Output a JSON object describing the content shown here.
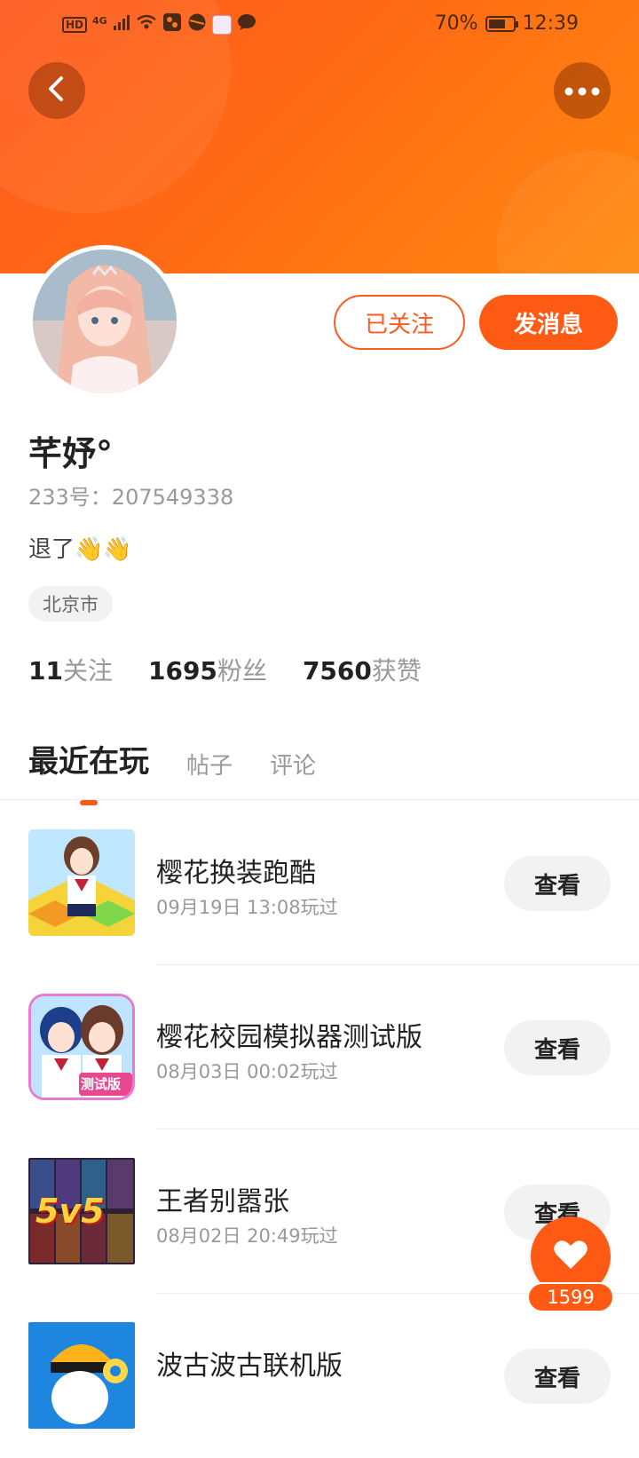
{
  "status_bar": {
    "network_badge": "HD",
    "network_type": "4G",
    "battery_text": "70%",
    "battery_level": 0.7,
    "time": "12:39"
  },
  "header": {
    "back_icon": "chevron-left-icon",
    "more_icon": "more-horizontal-icon"
  },
  "profile": {
    "follow_button_label": "已关注",
    "message_button_label": "发消息",
    "username": "芊妤°",
    "user_id": "233号：207549338",
    "bio": "退了👋👋",
    "location": "北京市",
    "stats": [
      {
        "num": "11",
        "label": "关注"
      },
      {
        "num": "1695",
        "label": "粉丝"
      },
      {
        "num": "7560",
        "label": "获赞"
      }
    ]
  },
  "tabs": [
    {
      "label": "最近在玩",
      "active": true
    },
    {
      "label": "帖子",
      "active": false
    },
    {
      "label": "评论",
      "active": false
    }
  ],
  "games": [
    {
      "name": "樱花换装跑酷",
      "time": "09月19日 13:08玩过",
      "button": "查看"
    },
    {
      "name": "樱花校园模拟器测试版",
      "time": "08月03日 00:02玩过",
      "button": "查看",
      "icon_text": "测试版"
    },
    {
      "name": "王者别嚣张",
      "time": "08月02日 20:49玩过",
      "button": "查看",
      "icon_text": "5v5"
    },
    {
      "name": "波古波古联机版",
      "time": "",
      "button": "查看"
    }
  ],
  "like_fab": {
    "icon": "heart-icon",
    "count": "1599"
  },
  "colors": {
    "accent": "#ff5a14",
    "header_gradient_start": "#ff5a1f",
    "header_gradient_end": "#ff8a10"
  }
}
